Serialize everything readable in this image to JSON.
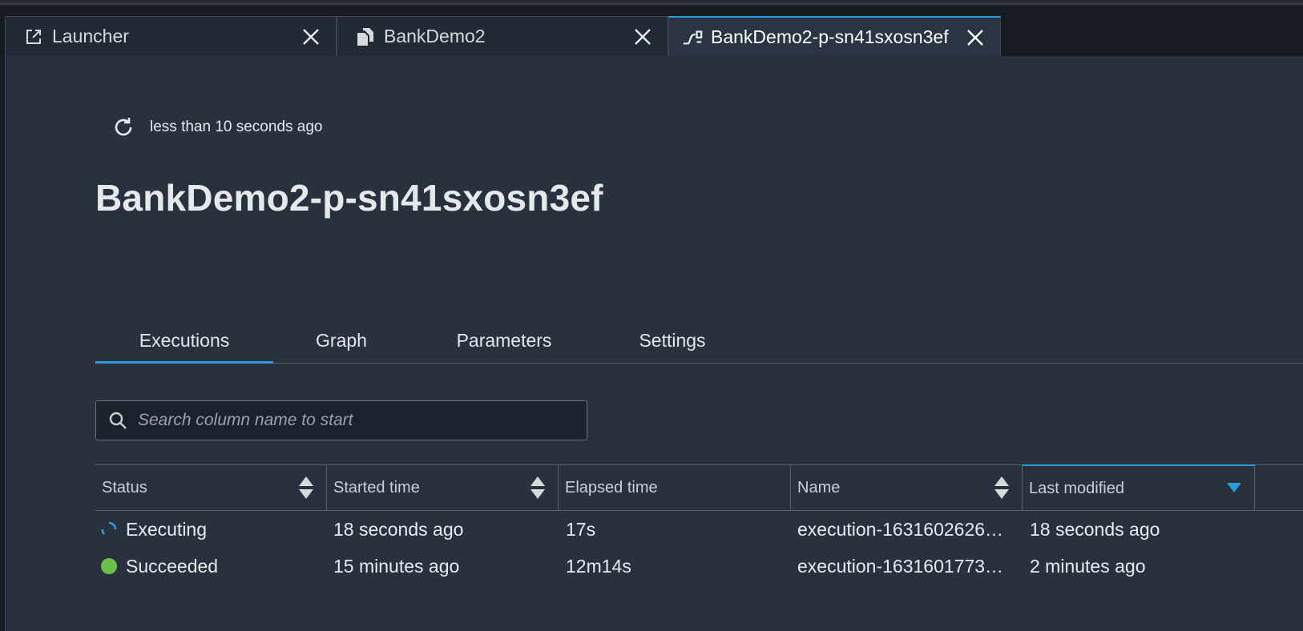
{
  "tabs": [
    {
      "label": "Launcher",
      "icon": "external-link-icon"
    },
    {
      "label": "BankDemo2",
      "icon": "files-icon"
    },
    {
      "label": "BankDemo2-p-sn41sxosn3ef",
      "icon": "pipeline-icon"
    }
  ],
  "refresh": {
    "text": "less than 10 seconds ago"
  },
  "page_title": "BankDemo2-p-sn41sxosn3ef",
  "nav_tabs": [
    "Executions",
    "Graph",
    "Parameters",
    "Settings"
  ],
  "search": {
    "placeholder": "Search column name to start"
  },
  "table": {
    "headers": [
      "Status",
      "Started time",
      "Elapsed time",
      "Name",
      "Last modified"
    ],
    "rows": [
      {
        "status": "Executing",
        "started": "18 seconds ago",
        "elapsed": "17s",
        "name": "execution-1631602626…",
        "modified": "18 seconds ago"
      },
      {
        "status": "Succeeded",
        "started": "15 minutes ago",
        "elapsed": "12m14s",
        "name": "execution-1631601773…",
        "modified": "2 minutes ago"
      }
    ]
  },
  "colors": {
    "accent": "#2e9cdb",
    "success": "#6cc04a",
    "background": "#29313f"
  }
}
